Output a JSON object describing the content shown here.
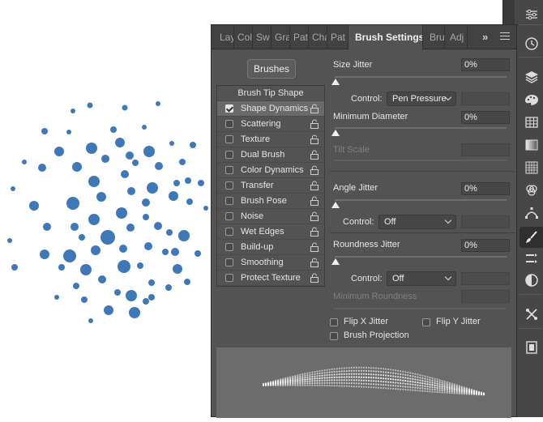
{
  "panel": {
    "tabs": [
      {
        "label": "Lay",
        "active": false
      },
      {
        "label": "Col",
        "active": false
      },
      {
        "label": "Sw",
        "active": false
      },
      {
        "label": "Gra",
        "active": false
      },
      {
        "label": "Pat",
        "active": false
      },
      {
        "label": "Cha",
        "active": false
      },
      {
        "label": "Pat",
        "active": false
      },
      {
        "label": "Brush Settings",
        "active": true
      },
      {
        "label": "Bru",
        "active": false
      },
      {
        "label": "Adj",
        "active": false
      }
    ],
    "overflow_label": "»",
    "brushes_button": "Brushes",
    "list_header": "Brush Tip Shape",
    "list_items": [
      {
        "label": "Shape Dynamics",
        "checked": true
      },
      {
        "label": "Scattering",
        "checked": false
      },
      {
        "label": "Texture",
        "checked": false
      },
      {
        "label": "Dual Brush",
        "checked": false
      },
      {
        "label": "Color Dynamics",
        "checked": false
      },
      {
        "label": "Transfer",
        "checked": false
      },
      {
        "label": "Brush Pose",
        "checked": false
      },
      {
        "label": "Noise",
        "checked": false
      },
      {
        "label": "Wet Edges",
        "checked": false
      },
      {
        "label": "Build-up",
        "checked": false
      },
      {
        "label": "Smoothing",
        "checked": false
      },
      {
        "label": "Protect Texture",
        "checked": false
      }
    ],
    "settings": {
      "size_jitter": {
        "label": "Size Jitter",
        "value": "0%"
      },
      "control_1": {
        "label": "Control:",
        "value": "Pen Pressure"
      },
      "minimum_diameter": {
        "label": "Minimum Diameter",
        "value": "0%"
      },
      "tilt_scale": {
        "label": "Tilt Scale"
      },
      "angle_jitter": {
        "label": "Angle Jitter",
        "value": "0%"
      },
      "control_2": {
        "label": "Control:",
        "value": "Off"
      },
      "roundness_jitter": {
        "label": "Roundness Jitter",
        "value": "0%"
      },
      "control_3": {
        "label": "Control:",
        "value": "Off"
      },
      "minimum_roundness": {
        "label": "Minimum Roundness"
      },
      "flip_x": {
        "label": "Flip X Jitter",
        "checked": false
      },
      "flip_y": {
        "label": "Flip Y Jitter",
        "checked": false
      },
      "brush_projection": {
        "label": "Brush Projection",
        "checked": false
      }
    }
  },
  "tool_strip": {
    "icons": [
      "adjustments-icon",
      "history-icon",
      "layers-icon",
      "color-palette-icon",
      "table-icon",
      "gradient-icon",
      "grid-icon",
      "channels-icon",
      "paths-icon",
      "brush-icon",
      "brush-presets-icon",
      "adjustments-circle-icon",
      "tools-icon",
      "artboard-icon"
    ]
  },
  "colors": {
    "dot_blue": "#2f6cb3",
    "panel_bg": "#535353",
    "tab_bg": "#424242"
  }
}
